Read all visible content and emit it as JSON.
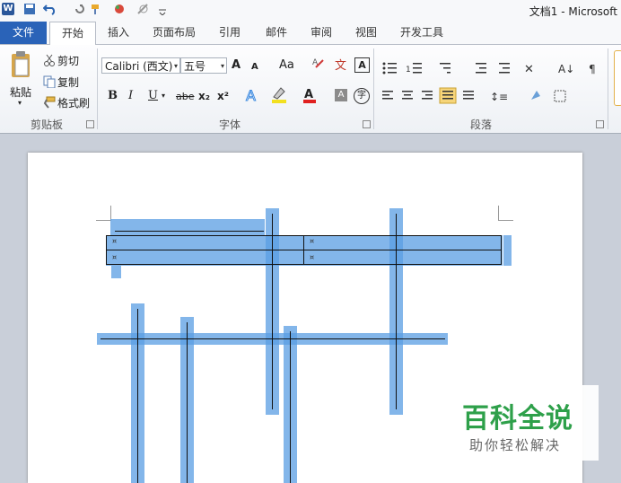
{
  "app": {
    "title": "文档1 - Microsoft"
  },
  "tabs": [
    "文件",
    "开始",
    "插入",
    "页面布局",
    "引用",
    "邮件",
    "审阅",
    "视图",
    "开发工具"
  ],
  "clipboard": {
    "paste": "粘贴",
    "cut": "剪切",
    "copy": "复制",
    "format_painter": "格式刷",
    "group": "剪贴板"
  },
  "font": {
    "name": "Calibri (西文)",
    "size": "五号",
    "case": "Aa",
    "bold": "B",
    "italic": "I",
    "underline": "U",
    "strike": "abe",
    "sub": "x₂",
    "sup": "x²",
    "grow": "A",
    "shrink": "A",
    "group": "字体"
  },
  "paragraph": {
    "group": "段落"
  },
  "watermark": {
    "title": "百科全说",
    "subtitle": "助你轻松解决"
  },
  "colors": {
    "file_tab": "#2a63b8",
    "selection": "#5a9ee3",
    "watermark_green": "#2ea04a"
  }
}
